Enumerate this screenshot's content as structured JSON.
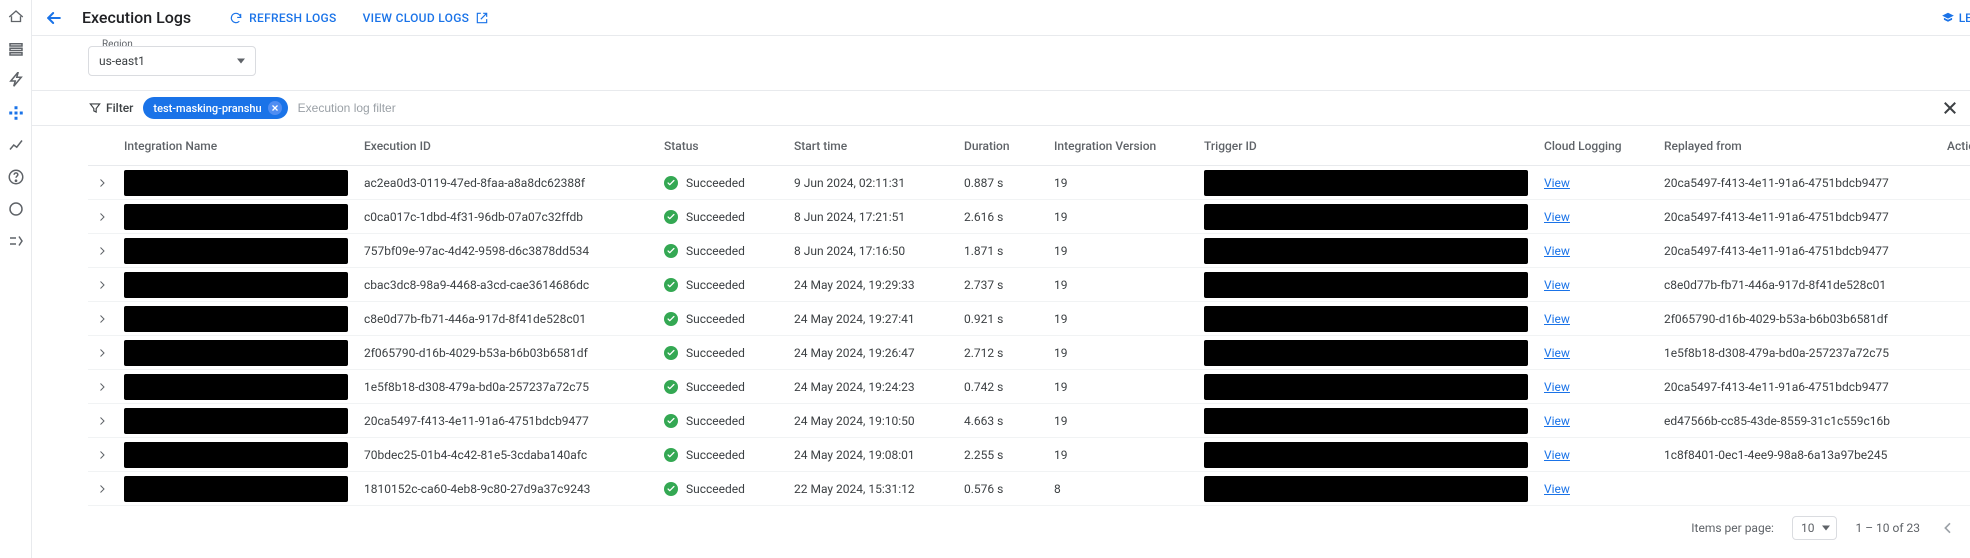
{
  "rail": {
    "items": [
      "logo",
      "list",
      "bolt",
      "integrations-active",
      "chart",
      "help",
      "circle",
      "connector"
    ]
  },
  "header": {
    "title": "Execution Logs",
    "refresh": "REFRESH LOGS",
    "view_cloud_logs": "VIEW CLOUD LOGS",
    "learn": "LEARN"
  },
  "region": {
    "label": "Region",
    "value": "us-east1"
  },
  "filter": {
    "button": "Filter",
    "chip": "test-masking-pranshu",
    "placeholder": "Execution log filter"
  },
  "columns": {
    "integration_name": "Integration Name",
    "execution_id": "Execution ID",
    "status": "Status",
    "start_time": "Start time",
    "duration": "Duration",
    "integration_version": "Integration Version",
    "trigger_id": "Trigger ID",
    "cloud_logging": "Cloud Logging",
    "replayed_from": "Replayed from",
    "actions": "Actions"
  },
  "status_labels": {
    "succeeded": "Succeeded"
  },
  "view_label": "View",
  "rows": [
    {
      "execution_id": "ac2ea0d3-0119-47ed-8faa-a8a8dc62388f",
      "start_time": "9 Jun 2024, 02:11:31",
      "duration": "0.887 s",
      "version": "19",
      "replayed_from": "20ca5497-f413-4e11-91a6-4751bdcb9477"
    },
    {
      "execution_id": "c0ca017c-1dbd-4f31-96db-07a07c32ffdb",
      "start_time": "8 Jun 2024, 17:21:51",
      "duration": "2.616 s",
      "version": "19",
      "replayed_from": "20ca5497-f413-4e11-91a6-4751bdcb9477"
    },
    {
      "execution_id": "757bf09e-97ac-4d42-9598-d6c3878dd534",
      "start_time": "8 Jun 2024, 17:16:50",
      "duration": "1.871 s",
      "version": "19",
      "replayed_from": "20ca5497-f413-4e11-91a6-4751bdcb9477"
    },
    {
      "execution_id": "cbac3dc8-98a9-4468-a3cd-cae3614686dc",
      "start_time": "24 May 2024, 19:29:33",
      "duration": "2.737 s",
      "version": "19",
      "replayed_from": "c8e0d77b-fb71-446a-917d-8f41de528c01"
    },
    {
      "execution_id": "c8e0d77b-fb71-446a-917d-8f41de528c01",
      "start_time": "24 May 2024, 19:27:41",
      "duration": "0.921 s",
      "version": "19",
      "replayed_from": "2f065790-d16b-4029-b53a-b6b03b6581df"
    },
    {
      "execution_id": "2f065790-d16b-4029-b53a-b6b03b6581df",
      "start_time": "24 May 2024, 19:26:47",
      "duration": "2.712 s",
      "version": "19",
      "replayed_from": "1e5f8b18-d308-479a-bd0a-257237a72c75"
    },
    {
      "execution_id": "1e5f8b18-d308-479a-bd0a-257237a72c75",
      "start_time": "24 May 2024, 19:24:23",
      "duration": "0.742 s",
      "version": "19",
      "replayed_from": "20ca5497-f413-4e11-91a6-4751bdcb9477"
    },
    {
      "execution_id": "20ca5497-f413-4e11-91a6-4751bdcb9477",
      "start_time": "24 May 2024, 19:10:50",
      "duration": "4.663 s",
      "version": "19",
      "replayed_from": "ed47566b-cc85-43de-8559-31c1c559c16b"
    },
    {
      "execution_id": "70bdec25-01b4-4c42-81e5-3cdaba140afc",
      "start_time": "24 May 2024, 19:08:01",
      "duration": "2.255 s",
      "version": "19",
      "replayed_from": "1c8f8401-0ec1-4ee9-98a8-6a13a97be245"
    },
    {
      "execution_id": "1810152c-ca60-4eb8-9c80-27d9a37c9243",
      "start_time": "22 May 2024, 15:31:12",
      "duration": "0.576 s",
      "version": "8",
      "replayed_from": ""
    }
  ],
  "footer": {
    "items_per_page_label": "Items per page:",
    "items_per_page_value": "10",
    "range": "1 – 10 of 23"
  }
}
